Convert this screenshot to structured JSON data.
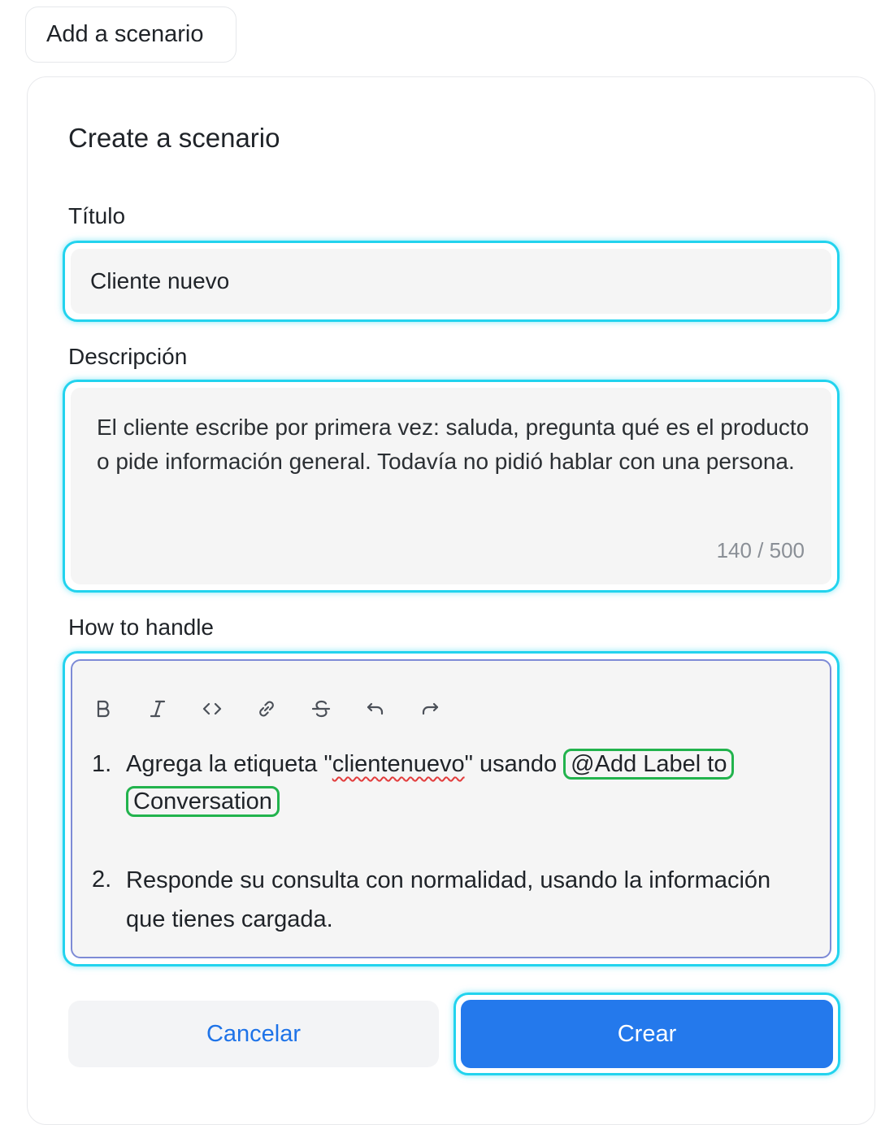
{
  "header": {
    "add_button_label": "Add a scenario"
  },
  "card": {
    "title": "Create a scenario",
    "title_field": {
      "label": "Título",
      "value": "Cliente nuevo"
    },
    "description_field": {
      "label": "Descripción",
      "value": "El cliente escribe por primera vez: saluda, pregunta qué es el producto o pide información general. Todavía no pidió hablar con una persona.",
      "counter": "140 / 500"
    },
    "handle_field": {
      "label": "How to handle",
      "toolbar": [
        "bold-icon",
        "italic-icon",
        "code-icon",
        "link-icon",
        "strikethrough-icon",
        "undo-icon",
        "redo-icon"
      ],
      "items": [
        {
          "num": "1.",
          "text_before": "Agrega la etiqueta \"",
          "misspelled": "clientenuevo",
          "text_after": "\" usando",
          "mention": "@Add Label to Conversation"
        },
        {
          "num": "2.",
          "text": "Responde su consulta con normalidad, usando la información que tienes cargada."
        }
      ]
    },
    "actions": {
      "cancel_label": "Cancelar",
      "create_label": "Crear"
    }
  },
  "colors": {
    "focus_ring": "#22d3ee",
    "mention_border": "#22b34d",
    "primary": "#2479ec",
    "link_text": "#1e73e8"
  }
}
